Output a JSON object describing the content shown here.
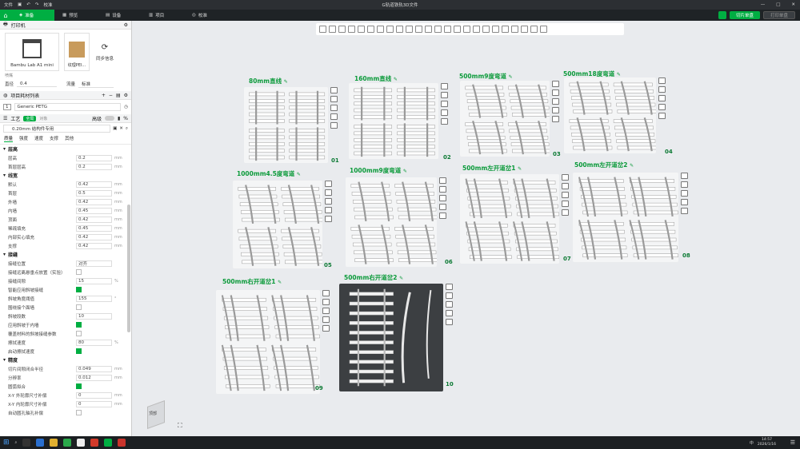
{
  "titlebar": {
    "file": "文件",
    "calib": "校准",
    "title": "G轨道铁轨3D文件"
  },
  "menu": {
    "tabs": [
      "准备",
      "预览",
      "设备",
      "项目",
      "校准"
    ],
    "slice_plate": "切片单盘",
    "print_plate": "打印单盘"
  },
  "printer": {
    "header": "打印机",
    "name": "Bambu Lab A1 mini",
    "plate": "纹理PEI...",
    "sync": "同步信息",
    "section": "喷嘴",
    "nozzle_label": "直径",
    "nozzle_value": "0.4",
    "flow_label": "流量",
    "flow_value": "标准"
  },
  "filament": {
    "header": "项目耗材列表",
    "index": "1",
    "name": "Generic PETG"
  },
  "process": {
    "header": "工艺",
    "badge": "全局",
    "badge2": "对象",
    "advanced": "高级",
    "preset": "0.20mm 结构件专用",
    "tabs": [
      "质量",
      "强度",
      "速度",
      "支撑",
      "其他"
    ],
    "groups": [
      {
        "title": "层高",
        "rows": [
          {
            "label": "层高",
            "value": "0.2",
            "unit": "mm"
          },
          {
            "label": "首层层高",
            "value": "0.2",
            "unit": "mm"
          }
        ]
      },
      {
        "title": "线宽",
        "rows": [
          {
            "label": "默认",
            "value": "0.42",
            "unit": "mm"
          },
          {
            "label": "首层",
            "value": "0.5",
            "unit": "mm"
          },
          {
            "label": "外墙",
            "value": "0.42",
            "unit": "mm"
          },
          {
            "label": "内墙",
            "value": "0.45",
            "unit": "mm"
          },
          {
            "label": "顶面",
            "value": "0.42",
            "unit": "mm"
          },
          {
            "label": "稀疏填充",
            "value": "0.45",
            "unit": "mm"
          },
          {
            "label": "内部实心填充",
            "value": "0.42",
            "unit": "mm"
          },
          {
            "label": "支撑",
            "value": "0.42",
            "unit": "mm"
          }
        ]
      },
      {
        "title": "接缝",
        "rows": [
          {
            "label": "接缝位置",
            "value": "对齐",
            "unit": ""
          },
          {
            "label": "接缝远离悬垂点放置（实验）",
            "check": false
          },
          {
            "label": "接缝间隙",
            "value": "15",
            "unit": "%"
          },
          {
            "label": "智能应用斜坡接缝",
            "check": true
          },
          {
            "label": "斜坡角度阈值",
            "value": "155",
            "unit": "°"
          },
          {
            "label": "围绕接个面墙",
            "check": false
          },
          {
            "label": "斜坡段数",
            "value": "10",
            "unit": ""
          },
          {
            "label": "应用斜坡于内墙",
            "check": true
          },
          {
            "label": "覆盖材料的斜坡接缝参数",
            "check": false
          },
          {
            "label": "擦拭速度",
            "value": "80",
            "unit": "%"
          },
          {
            "label": "启动擦拭速度",
            "check": true
          }
        ]
      },
      {
        "title": "精度",
        "rows": [
          {
            "label": "切片间隙闭合半径",
            "value": "0.049",
            "unit": "mm"
          },
          {
            "label": "分辨率",
            "value": "0.012",
            "unit": "mm"
          },
          {
            "label": "圆弧拟合",
            "check": true
          },
          {
            "label": "X-Y 外轮廓尺寸补偿",
            "value": "0",
            "unit": "mm"
          },
          {
            "label": "X-Y 内轮廓尺寸补偿",
            "value": "0",
            "unit": "mm"
          },
          {
            "label": "自动圆孔轴孔补偿",
            "check": false
          }
        ]
      }
    ]
  },
  "plates": [
    {
      "label": "80mm直线",
      "num": "01"
    },
    {
      "label": "160mm直线",
      "num": "02"
    },
    {
      "label": "500mm9度弯道",
      "num": "03"
    },
    {
      "label": "500mm18度弯道",
      "num": "04"
    },
    {
      "label": "1000mm4.5度弯道",
      "num": "05"
    },
    {
      "label": "1000mm9度弯道",
      "num": "06"
    },
    {
      "label": "500mm左开道岔1",
      "num": "07"
    },
    {
      "label": "500mm左开道岔2",
      "num": "08"
    },
    {
      "label": "500mm右开道岔1",
      "num": "09"
    },
    {
      "label": "500mm右开道岔2",
      "num": "10"
    }
  ],
  "preview_label": "顶部",
  "taskbar": {
    "time": "14:57",
    "date": "2026/1/16",
    "lang": "中"
  },
  "colors": {
    "accent": "#00ae42",
    "label_green": "#0b9a3a"
  }
}
